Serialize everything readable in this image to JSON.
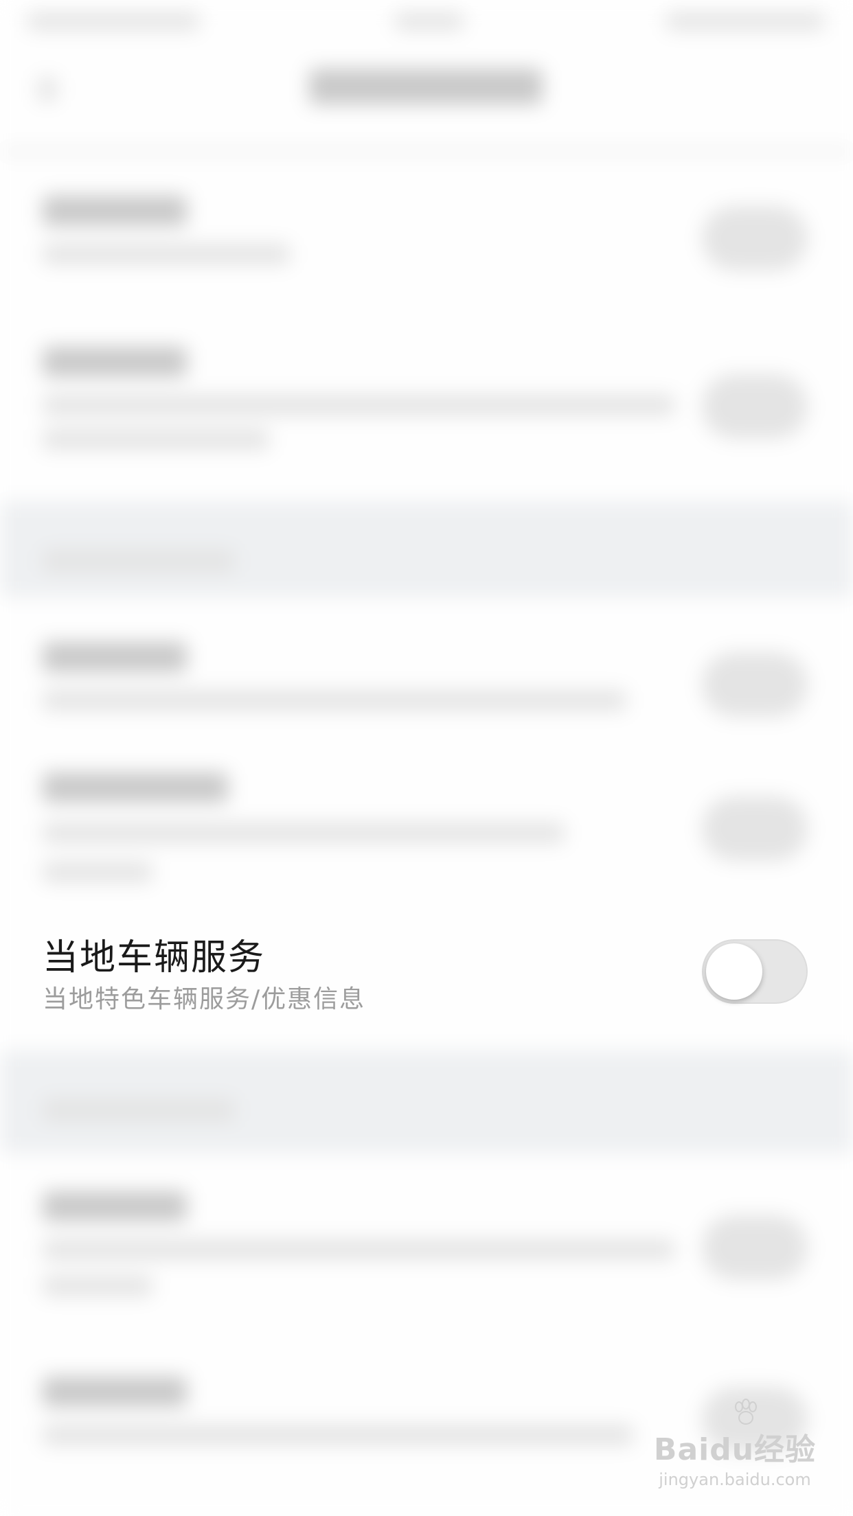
{
  "setting": {
    "title": "当地车辆服务",
    "subtitle": "当地特色车辆服务/优惠信息",
    "toggle_on": false
  },
  "watermark": {
    "logo": "Baidu经验",
    "url": "jingyan.baidu.com"
  },
  "colors": {
    "toggle_off": "#e6e6e6",
    "title_text": "#1a1a1a",
    "subtitle_text": "#9c9c9c"
  }
}
